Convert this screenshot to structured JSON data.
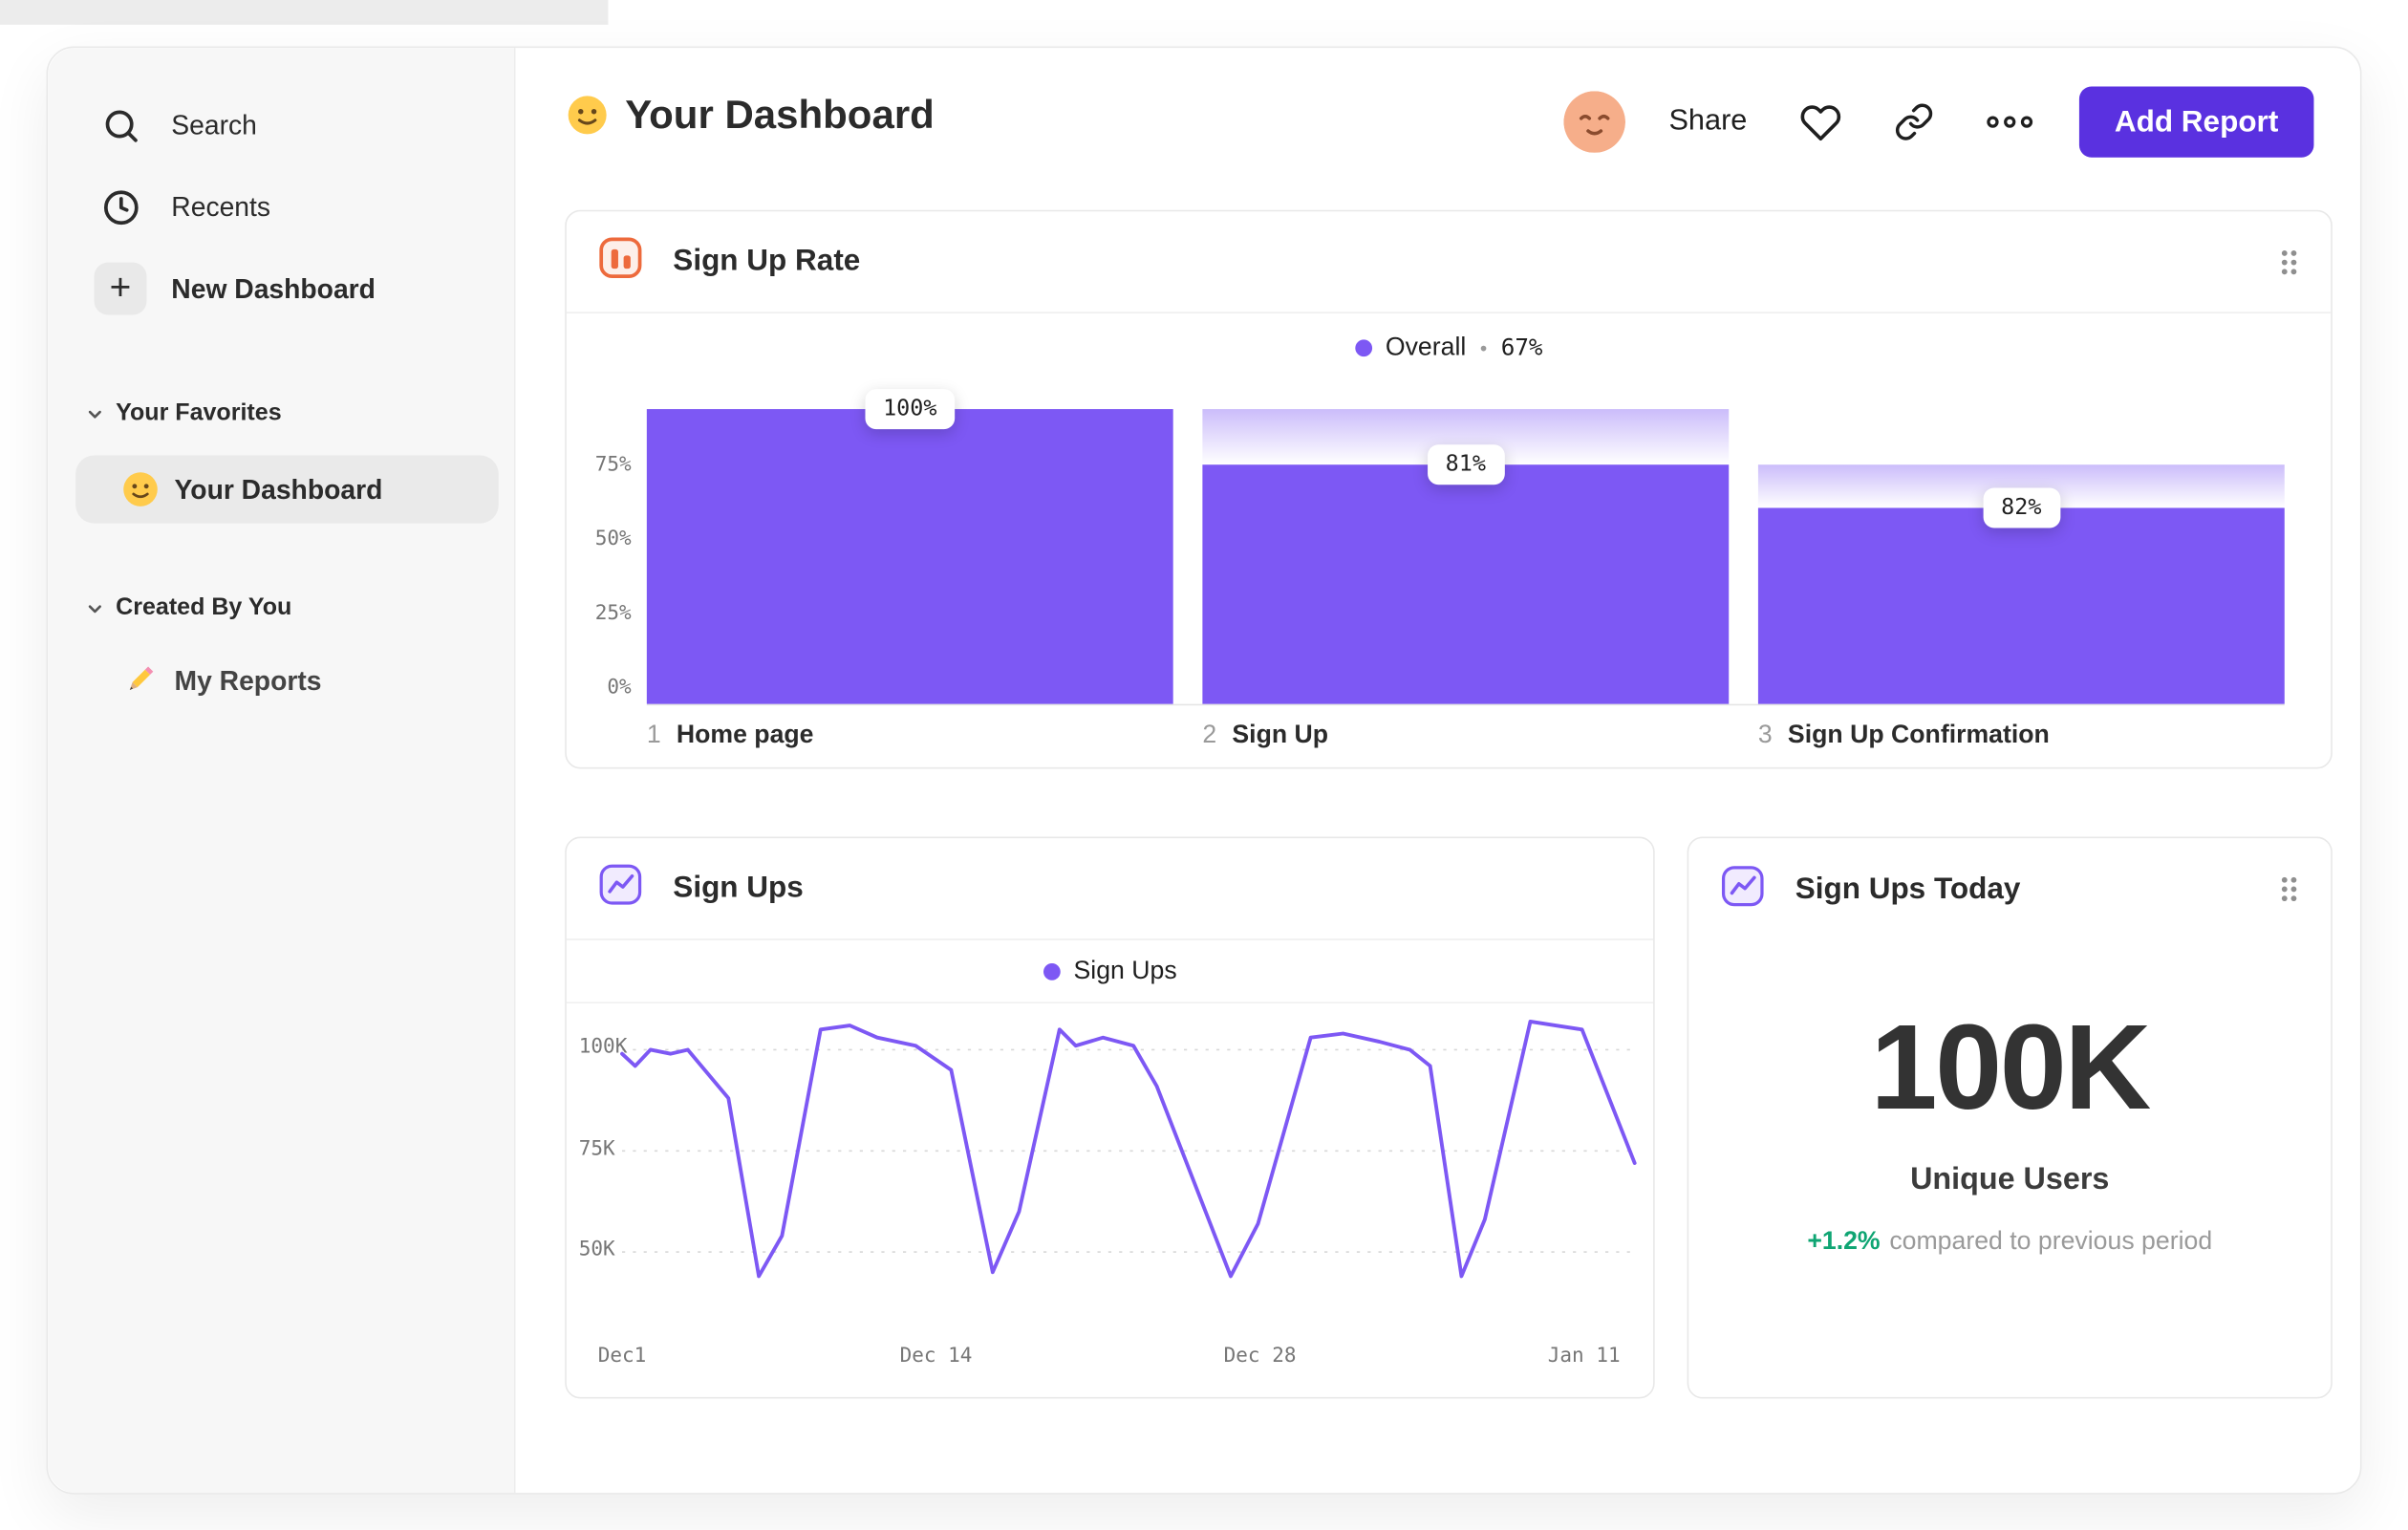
{
  "colors": {
    "accent_purple": "#7D58F4",
    "button_purple": "#5A31E0",
    "icon_orange": "#ED6A3C",
    "positive_green": "#0FA573"
  },
  "sidebar": {
    "search_label": "Search",
    "recents_label": "Recents",
    "new_dashboard_label": "New Dashboard",
    "plus_glyph": "+",
    "favorites": {
      "label": "Your Favorites",
      "item_label": "Your Dashboard"
    },
    "created": {
      "label": "Created By You",
      "item_label": "My Reports"
    }
  },
  "header": {
    "title": "Your Dashboard",
    "share_label": "Share",
    "add_report_label": "Add Report"
  },
  "funnel_card": {
    "title": "Sign Up Rate",
    "type": "bar",
    "legend_label": "Overall",
    "legend_separator": "•",
    "legend_value": "67%",
    "y_ticks": [
      {
        "label": "75%",
        "value": 75
      },
      {
        "label": "50%",
        "value": 50
      },
      {
        "label": "25%",
        "value": 25
      },
      {
        "label": "0%",
        "value": 0
      }
    ],
    "steps": [
      {
        "index": "1",
        "label": "Home page",
        "badge": "100%",
        "value": 100,
        "prev": 100
      },
      {
        "index": "2",
        "label": "Sign Up",
        "badge": "81%",
        "value": 81,
        "prev": 100
      },
      {
        "index": "3",
        "label": "Sign Up Confirmation",
        "badge": "82%",
        "value": 66.4,
        "prev": 81
      }
    ]
  },
  "line_card": {
    "title": "Sign Ups",
    "type": "line",
    "legend_label": "Sign Ups",
    "y_ticks": [
      {
        "label": "100K",
        "value": 100
      },
      {
        "label": "75K",
        "value": 75
      },
      {
        "label": "50K",
        "value": 50
      }
    ],
    "x_ticks": [
      {
        "label": "Dec1",
        "pos": 0.0
      },
      {
        "label": "Dec 14",
        "pos": 0.31
      },
      {
        "label": "Dec 28",
        "pos": 0.63
      },
      {
        "label": "Jan 11",
        "pos": 0.95
      }
    ],
    "series": {
      "name": "Sign Ups",
      "unit": "K",
      "points": [
        [
          0.0,
          99
        ],
        [
          0.013,
          96
        ],
        [
          0.028,
          100
        ],
        [
          0.048,
          99
        ],
        [
          0.065,
          100
        ],
        [
          0.075,
          97
        ],
        [
          0.105,
          88
        ],
        [
          0.135,
          44
        ],
        [
          0.158,
          54
        ],
        [
          0.196,
          105
        ],
        [
          0.225,
          106
        ],
        [
          0.252,
          103
        ],
        [
          0.29,
          101
        ],
        [
          0.325,
          95
        ],
        [
          0.366,
          45
        ],
        [
          0.392,
          60
        ],
        [
          0.432,
          105
        ],
        [
          0.448,
          101
        ],
        [
          0.475,
          103
        ],
        [
          0.505,
          101
        ],
        [
          0.528,
          91
        ],
        [
          0.601,
          44
        ],
        [
          0.628,
          57
        ],
        [
          0.68,
          103
        ],
        [
          0.712,
          104
        ],
        [
          0.748,
          102
        ],
        [
          0.778,
          100
        ],
        [
          0.798,
          96
        ],
        [
          0.829,
          44
        ],
        [
          0.852,
          58
        ],
        [
          0.897,
          107
        ],
        [
          0.922,
          106
        ],
        [
          0.948,
          105
        ],
        [
          1.0,
          72
        ]
      ]
    }
  },
  "metric_card": {
    "title": "Sign Ups Today",
    "value": "100K",
    "label": "Unique Users",
    "delta": "+1.2%",
    "delta_description": "compared to previous period"
  }
}
